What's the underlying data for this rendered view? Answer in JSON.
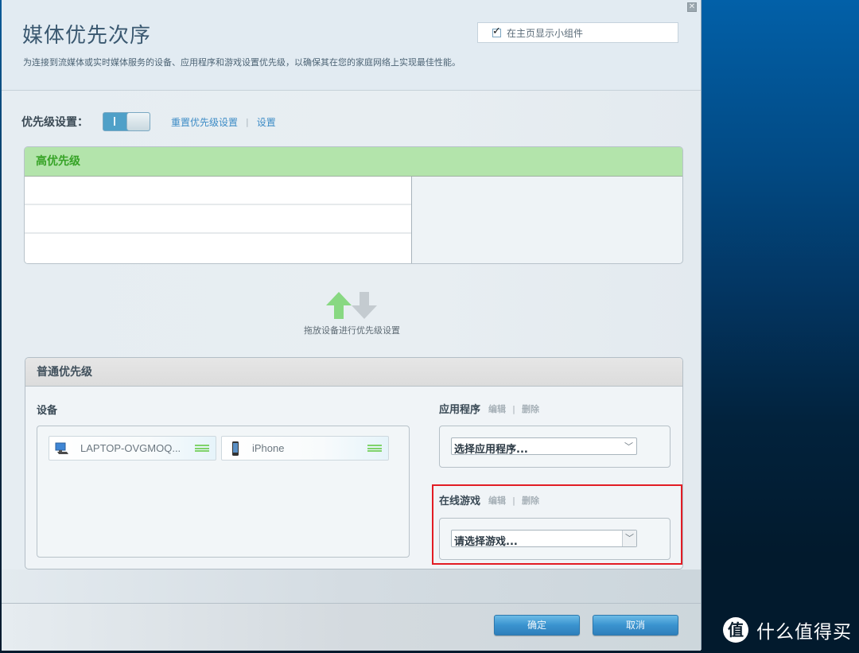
{
  "window": {
    "title": "媒体优先次序",
    "description": "为连接到流媒体或实时媒体服务的设备、应用程序和游戏设置优先级，以确保其在您的家庭网络上实现最佳性能。",
    "close_icon": "close-icon",
    "show_widget": {
      "label": "在主页显示小组件",
      "checked": true
    }
  },
  "priority_settings": {
    "label": "优先级设置：",
    "switch": {
      "state": "on",
      "on_label": "I"
    },
    "reset_link": "重置优先级设置",
    "separator": "|",
    "settings_link": "设置"
  },
  "high_priority": {
    "title": "高优先级",
    "slots": [
      "",
      "",
      ""
    ],
    "color": "#36a326",
    "header_bg": "#b3e4ab"
  },
  "drag_hint": {
    "text": "拖放设备进行优先级设置",
    "icons": [
      "arrow-up-icon",
      "arrow-down-icon"
    ]
  },
  "normal_priority": {
    "title": "普通优先级",
    "devices_label": "设备",
    "devices": [
      {
        "name": "LAPTOP-OVGMOQ...",
        "icon": "laptop-icon"
      },
      {
        "name": "iPhone",
        "icon": "phone-icon"
      }
    ],
    "applications": {
      "label": "应用程序",
      "edit": "编辑",
      "delete": "删除",
      "separator": "|",
      "select_value": "选择应用程序..."
    },
    "online_games": {
      "label": "在线游戏",
      "edit": "编辑",
      "delete": "删除",
      "separator": "|",
      "select_value": "请选择游戏..."
    }
  },
  "footer": {
    "ok_label": "确定",
    "cancel_label": "取消"
  },
  "watermark": {
    "logo_char": "值",
    "text": "什么值得买"
  },
  "colors": {
    "accent_blue": "#3d8cc6",
    "button_blue": "#3a93cf",
    "highlight_red": "#e21c24",
    "grip_green": "#7fd36a"
  }
}
